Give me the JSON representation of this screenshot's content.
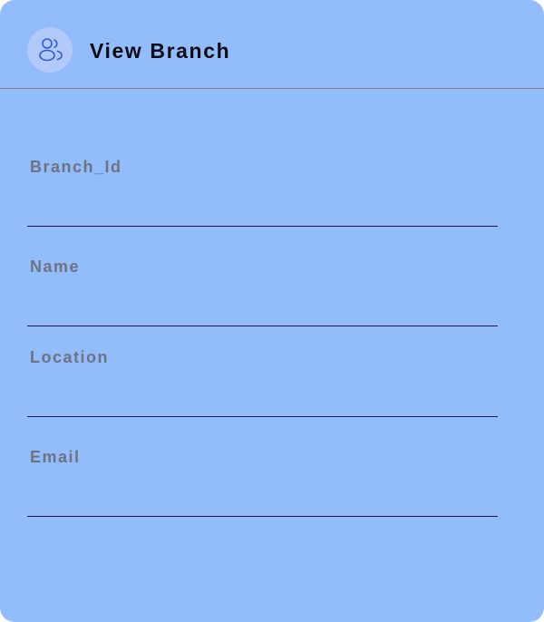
{
  "header": {
    "title": "View Branch",
    "icon": "users-icon"
  },
  "form": {
    "fields": [
      {
        "label": "Branch_Id",
        "value": ""
      },
      {
        "label": "Name",
        "value": ""
      },
      {
        "label": "Location",
        "value": ""
      },
      {
        "label": "Email",
        "value": ""
      }
    ]
  },
  "colors": {
    "card_background": "#93bcfa",
    "icon_circle": "#b2c9fb",
    "icon_stroke": "#2f5bd3",
    "label_text": "#6c7382",
    "underline": "#1f1640"
  }
}
